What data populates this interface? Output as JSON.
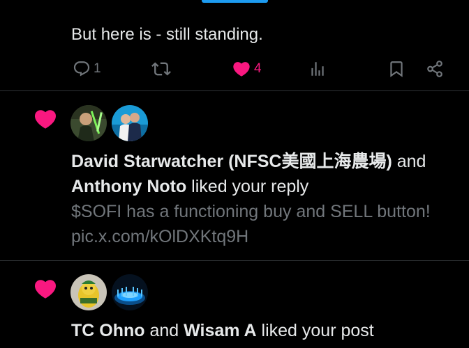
{
  "reply": {
    "text": "But here is - still standing.",
    "replies_count": "1",
    "likes_count": "4",
    "icons": {
      "reply": "reply-icon",
      "retweet": "retweet-icon",
      "like": "heart-filled-icon",
      "views": "views-bar-chart-icon",
      "bookmark": "bookmark-icon",
      "share": "share-icon"
    }
  },
  "notifications": [
    {
      "type": "like",
      "icon": "heart-filled-icon",
      "actor1": "David Starwatcher (NFSC美國上海農場)",
      "connector1": " and",
      "actor2": "Anthony Noto",
      "action": " liked your reply",
      "preview_line1": "$SOFI has a functioning buy and SELL button!",
      "preview_line2": "pic.x.com/kOlDXKtq9H",
      "avatars": [
        "avatar-david-starwatcher",
        "avatar-anthony-noto"
      ]
    },
    {
      "type": "like",
      "icon": "heart-filled-icon",
      "actor1": "TC Ohno",
      "connector1": " and ",
      "actor2": "Wisam A",
      "action": " liked your post",
      "avatars": [
        "avatar-tc-ohno",
        "avatar-wisam-a"
      ]
    }
  ],
  "colors": {
    "background": "#000000",
    "text_primary": "#e7e9ea",
    "text_secondary": "#71767b",
    "like_pink": "#f91880",
    "accent_blue": "#1d9bf0",
    "divider": "#2f3336"
  }
}
